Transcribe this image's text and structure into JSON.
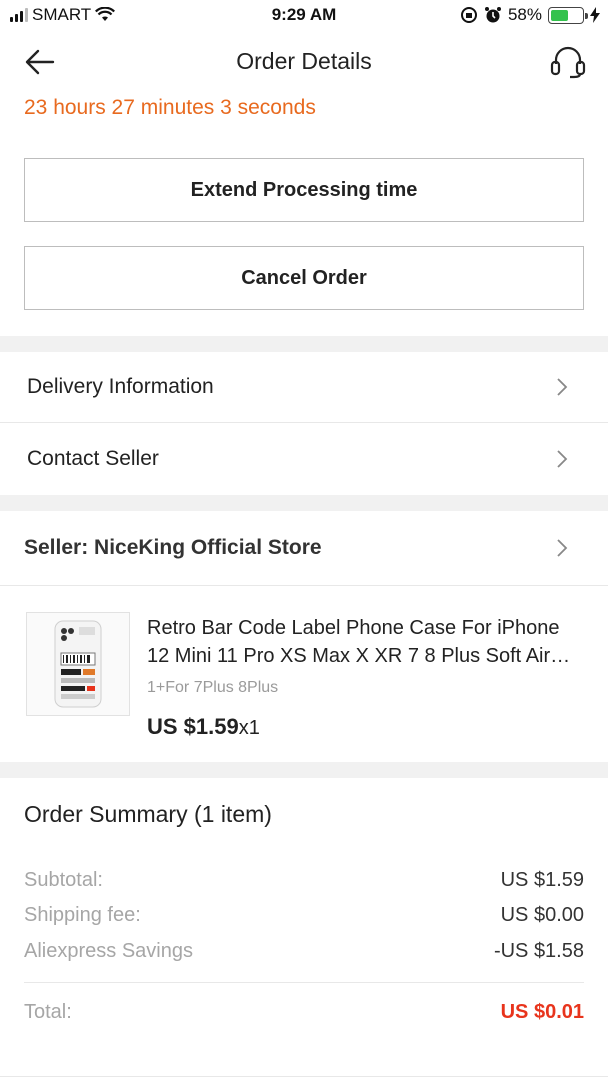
{
  "status_bar": {
    "carrier": "SMART",
    "time": "9:29 AM",
    "battery_percent": "58%",
    "battery_level": 0.58,
    "battery_color": "#33c24d"
  },
  "nav": {
    "title": "Order Details",
    "back_icon": "arrow-left-icon",
    "support_icon": "headset-icon"
  },
  "countdown": "23 hours 27 minutes 3 seconds",
  "buttons": {
    "extend": "Extend Processing time",
    "cancel": "Cancel Order"
  },
  "links": {
    "delivery": "Delivery Information",
    "contact": "Contact Seller"
  },
  "seller": {
    "label": "Seller: NiceKing Official Store"
  },
  "product": {
    "title": "Retro Bar Code Label Phone Case For iPhone 12 Mini 11 Pro XS Max X XR 7 8 Plus Soft Air Cushion Cover",
    "variant": "1+For 7Plus 8Plus",
    "price": "US $1.59",
    "quantity": "x1"
  },
  "summary": {
    "title": "Order Summary (1 item)",
    "subtotal_label": "Subtotal:",
    "subtotal_value": "US $1.59",
    "shipping_label": "Shipping fee:",
    "shipping_value": "US $0.00",
    "savings_label": "Aliexpress Savings",
    "savings_value": "-US $1.58",
    "total_label": "Total:",
    "total_value": "US $0.01"
  },
  "colors": {
    "accent_orange": "#e86a1f",
    "total_red": "#e8341c"
  }
}
